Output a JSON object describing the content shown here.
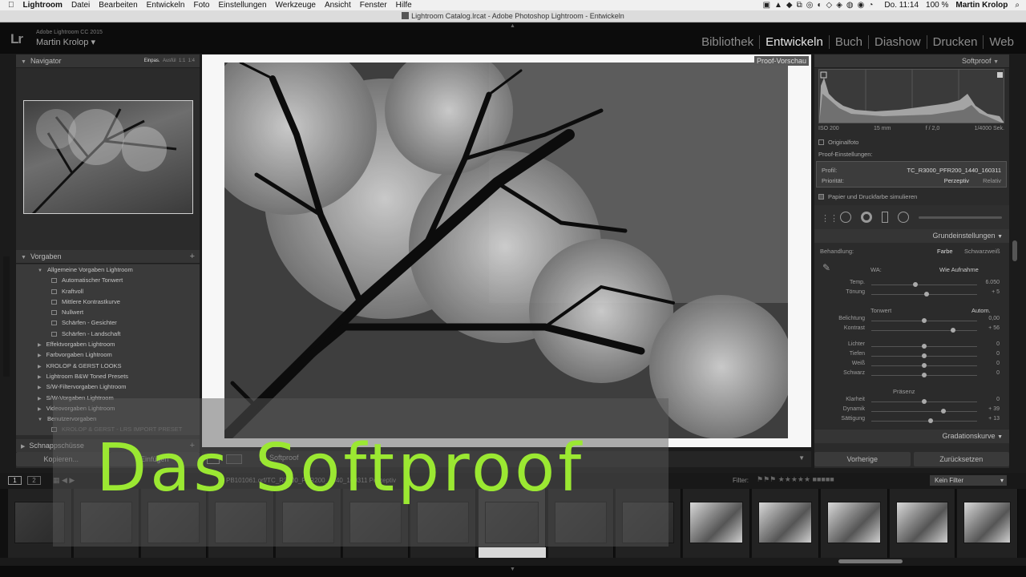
{
  "menubar": {
    "apple": "",
    "items": [
      "Lightroom",
      "Datei",
      "Bearbeiten",
      "Entwickeln",
      "Foto",
      "Einstellungen",
      "Werkzeuge",
      "Ansicht",
      "Fenster",
      "Hilfe"
    ],
    "clock": "Do. 11:14",
    "battery": "100 %",
    "user": "Martin Krolop",
    "search_icon": "⌕"
  },
  "window": {
    "title": "Lightroom Catalog.lrcat - Adobe Photoshop Lightroom - Entwickeln"
  },
  "header": {
    "logo": "Lr",
    "version": "Adobe Lightroom CC 2015",
    "user": "Martin Krolop ▾",
    "modules": [
      "Bibliothek",
      "Entwickeln",
      "Buch",
      "Diashow",
      "Drucken",
      "Web"
    ],
    "active_module": "Entwickeln"
  },
  "navigator": {
    "title": "Navigator",
    "options": [
      "Einpas.",
      "Ausfül",
      "1:1",
      "1:4"
    ]
  },
  "presets": {
    "title": "Vorgaben",
    "items": [
      {
        "label": "Allgemeine Vorgaben Lightroom",
        "level": 1,
        "toggle": "▼"
      },
      {
        "label": "Automatischer Tonwert",
        "level": 2
      },
      {
        "label": "Kraftvoll",
        "level": 2
      },
      {
        "label": "Mittlere Kontrastkurve",
        "level": 2
      },
      {
        "label": "Nullwert",
        "level": 2
      },
      {
        "label": "Schärfen - Gesichter",
        "level": 2
      },
      {
        "label": "Schärfen - Landschaft",
        "level": 2
      },
      {
        "label": "Effektvorgaben Lightroom",
        "level": 1,
        "toggle": "▶"
      },
      {
        "label": "Farbvorgaben Lightroom",
        "level": 1,
        "toggle": "▶"
      },
      {
        "label": "KROLOP & GERST LOOKS",
        "level": 1,
        "toggle": "▶"
      },
      {
        "label": "Lightroom B&W Toned Presets",
        "level": 1,
        "toggle": "▶"
      },
      {
        "label": "S/W-Filtervorgaben Lightroom",
        "level": 1,
        "toggle": "▶"
      },
      {
        "label": "S/W-Vorgaben Lightroom",
        "level": 1,
        "toggle": "▶"
      },
      {
        "label": "Videovorgaben Lightroom",
        "level": 1,
        "toggle": "▶"
      },
      {
        "label": "Benutzervorgaben",
        "level": 1,
        "toggle": "▼"
      },
      {
        "label": "KROLOP & GERST - LRS IMPORT PRESET",
        "level": 2,
        "dim": true
      }
    ],
    "snapshots_title": "Schnappschüsse"
  },
  "left_buttons": {
    "copy": "Kopieren...",
    "paste": "Einfügen"
  },
  "center": {
    "proof_badge": "Proof-Vorschau",
    "softproof_label": "Softproof"
  },
  "softproof_panel": {
    "title": "Softproof",
    "exif": [
      "ISO 200",
      "15 mm",
      "f / 2,0",
      "1/4000 Sek."
    ],
    "original_photo": "Originalfoto",
    "settings_label": "Proof-Einstellungen:",
    "profile_label": "Profil:",
    "profile_value": "TC_R3000_PFR200_1440_160311",
    "priority_label": "Priorität:",
    "priority_options": [
      "Perzeptiv",
      "Relativ"
    ],
    "simulate_label": "Papier und Druckfarbe simulieren"
  },
  "basic": {
    "title": "Grundeinstellungen",
    "treatment_label": "Behandlung:",
    "treatment_options": [
      "Farbe",
      "Schwarzweiß"
    ],
    "wb_label": "WA:",
    "wb_value": "Wie Aufnahme",
    "tone_label": "Tonwert",
    "tone_auto": "Autom.",
    "presence_label": "Präsenz",
    "sliders": [
      {
        "label": "Temp.",
        "value": "6.050",
        "pos": 0.42,
        "group": "wb"
      },
      {
        "label": "Tönung",
        "value": "+ 5",
        "pos": 0.52,
        "group": "wb"
      },
      {
        "label": "Belichtung",
        "value": "0,00",
        "pos": 0.5,
        "group": "tone"
      },
      {
        "label": "Kontrast",
        "value": "+ 56",
        "pos": 0.77,
        "group": "tone"
      },
      {
        "label": "Lichter",
        "value": "0",
        "pos": 0.5,
        "group": "tone2"
      },
      {
        "label": "Tiefen",
        "value": "0",
        "pos": 0.5,
        "group": "tone2"
      },
      {
        "label": "Weiß",
        "value": "0",
        "pos": 0.5,
        "group": "tone2"
      },
      {
        "label": "Schwarz",
        "value": "0",
        "pos": 0.5,
        "group": "tone2"
      },
      {
        "label": "Klarheit",
        "value": "0",
        "pos": 0.5,
        "group": "presence"
      },
      {
        "label": "Dynamik",
        "value": "+ 39",
        "pos": 0.68,
        "group": "presence"
      },
      {
        "label": "Sättigung",
        "value": "+ 13",
        "pos": 0.56,
        "group": "presence"
      }
    ]
  },
  "tone_curve": {
    "title": "Gradationskurve"
  },
  "right_buttons": {
    "previous": "Vorherige",
    "reset": "Zurücksetzen"
  },
  "filmstrip_bar": {
    "pages": [
      "1",
      "2"
    ],
    "path": "PB101061.orf/TC_R3000_PFR200_1440_160311  Perzeptiv",
    "filter_label": "Filter:",
    "filter_value": "Kein Filter"
  },
  "overlay": {
    "title": "Das Softproof"
  }
}
